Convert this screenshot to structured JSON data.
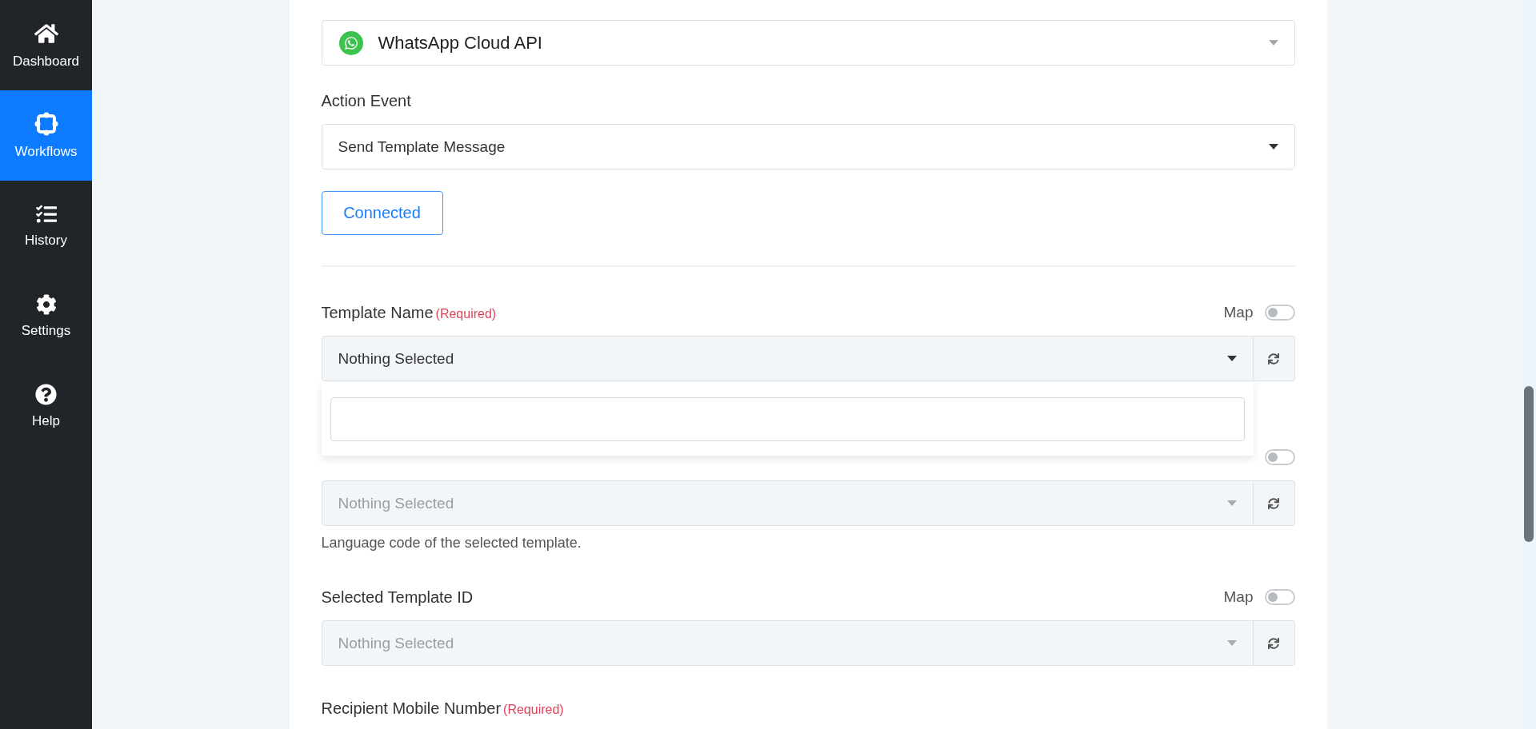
{
  "sidebar": {
    "items": [
      {
        "label": "Dashboard",
        "kind": "home",
        "selected": false
      },
      {
        "label": "Workflows",
        "kind": "workflow",
        "selected": true
      },
      {
        "label": "History",
        "kind": "checklist",
        "selected": false
      },
      {
        "label": "Settings",
        "kind": "gear",
        "selected": false
      },
      {
        "label": "Help",
        "kind": "help",
        "selected": false
      }
    ]
  },
  "choose_app": {
    "value": "WhatsApp Cloud API"
  },
  "action_event": {
    "label": "Action Event",
    "value": "Send Template Message"
  },
  "connect_button": "Connected",
  "fields": [
    {
      "label": "Template Name",
      "required": "(Required)",
      "map_label": "Map",
      "map_on": false,
      "value": "Nothing Selected",
      "disabled": false,
      "open": true
    },
    {
      "map_on": false,
      "value": "Nothing Selected",
      "disabled": true,
      "open": false,
      "hint": "Language code of the selected template."
    },
    {
      "label": "Selected Template ID",
      "map_label": "Map",
      "map_on": false,
      "value": "Nothing Selected",
      "disabled": true,
      "open": false
    }
  ],
  "next_field": {
    "label": "Recipient Mobile Number",
    "required": "(Required)"
  }
}
